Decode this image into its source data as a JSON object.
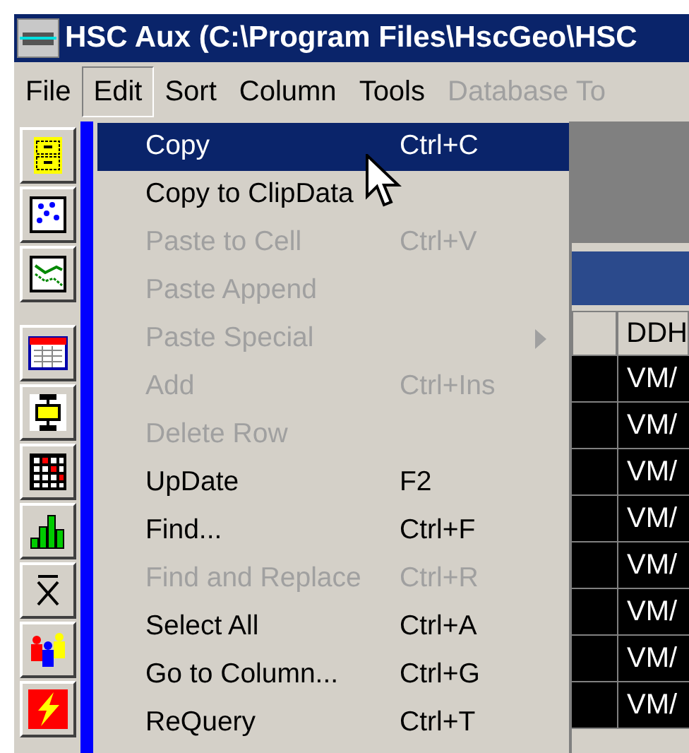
{
  "window": {
    "title": "HSC Aux (C:\\Program Files\\HscGeo\\HSC"
  },
  "menu_bar": [
    {
      "label": "File",
      "selected": false,
      "disabled": false
    },
    {
      "label": "Edit",
      "selected": true,
      "disabled": false
    },
    {
      "label": "Sort",
      "selected": false,
      "disabled": false
    },
    {
      "label": "Column",
      "selected": false,
      "disabled": false
    },
    {
      "label": "Tools",
      "selected": false,
      "disabled": false
    },
    {
      "label": "Database To",
      "selected": false,
      "disabled": true
    }
  ],
  "toolbar": [
    {
      "kind": "cabinet"
    },
    {
      "kind": "scatter"
    },
    {
      "kind": "lines"
    },
    {
      "kind": "table"
    },
    {
      "kind": "hinge"
    },
    {
      "kind": "grid"
    },
    {
      "kind": "bars"
    },
    {
      "kind": "xbar"
    },
    {
      "kind": "people"
    },
    {
      "kind": "bolt"
    }
  ],
  "edit_menu": [
    {
      "label": "Copy",
      "shortcut": "Ctrl+C",
      "selected": true,
      "disabled": false
    },
    {
      "label": "Copy to ClipData",
      "selected": false,
      "disabled": false
    },
    {
      "label": "Paste to Cell",
      "shortcut": "Ctrl+V",
      "selected": false,
      "disabled": true
    },
    {
      "label": "Paste Append",
      "selected": false,
      "disabled": true
    },
    {
      "label": "Paste Special",
      "selected": false,
      "disabled": true,
      "submenu": true
    },
    {
      "label": "Add",
      "shortcut": "Ctrl+Ins",
      "selected": false,
      "disabled": true
    },
    {
      "label": "Delete Row",
      "selected": false,
      "disabled": true
    },
    {
      "label": "UpDate",
      "shortcut": "F2",
      "selected": false,
      "disabled": false
    },
    {
      "label": "Find...",
      "shortcut": "Ctrl+F",
      "selected": false,
      "disabled": false
    },
    {
      "label": "Find and Replace",
      "shortcut": "Ctrl+R",
      "selected": false,
      "disabled": true
    },
    {
      "label": "Select All",
      "shortcut": "Ctrl+A",
      "selected": false,
      "disabled": false
    },
    {
      "label": "Go to Column...",
      "shortcut": "Ctrl+G",
      "selected": false,
      "disabled": false
    },
    {
      "label": "ReQuery",
      "shortcut": "Ctrl+T",
      "selected": false,
      "disabled": false
    }
  ],
  "table": {
    "columns": [
      "DDH"
    ],
    "rows": [
      "VM/",
      "VM/",
      "VM/",
      "VM/",
      "VM/",
      "VM/",
      "VM/",
      "VM/"
    ]
  }
}
